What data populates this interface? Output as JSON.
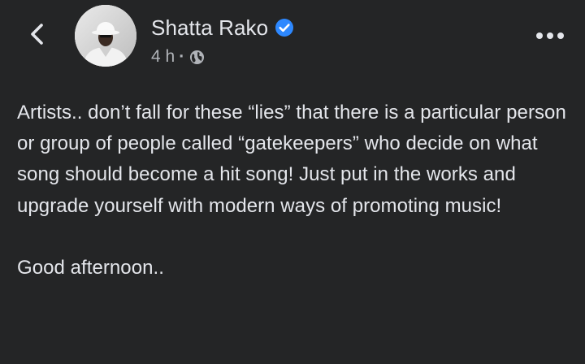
{
  "post": {
    "author": {
      "name": "Shatta Rako",
      "verified": true,
      "avatar_icon": "avatar-photo"
    },
    "meta": {
      "time": "4 h",
      "separator": "·",
      "audience_icon": "globe-icon"
    },
    "actions": {
      "back_icon": "chevron-left-icon",
      "more_icon": "more-dots-icon"
    },
    "body": {
      "paragraph_1": "Artists.. don’t fall for these “lies” that there is a particular person or group of people called “gatekeepers” who decide on what song should become a hit song! Just put in the works and upgrade yourself with modern ways of promoting music!",
      "paragraph_2": "Good afternoon.."
    }
  },
  "colors": {
    "background": "#242526",
    "primary_text": "#e4e6eb",
    "secondary_text": "#b0b3b8",
    "verified_blue": "#2d88ff"
  }
}
